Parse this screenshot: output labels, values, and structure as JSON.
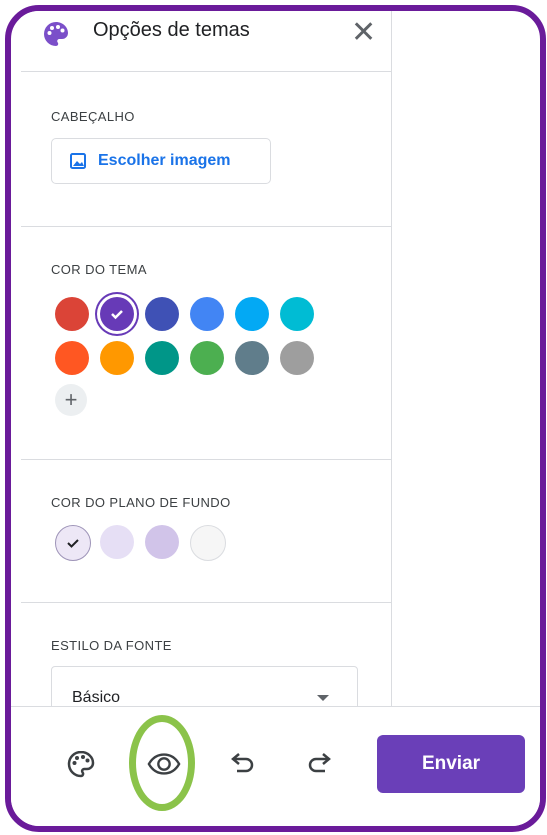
{
  "header": {
    "title": "Opções de temas",
    "close_label": "✕"
  },
  "sections": {
    "header_section": {
      "label": "CABEÇALHO",
      "button_label": "Escolher imagem"
    },
    "theme_color": {
      "label": "COR DO TEMA",
      "colors": [
        "#db4437",
        "#673ab7",
        "#3f51b5",
        "#4285f4",
        "#03a9f4",
        "#00bcd4",
        "#ff5722",
        "#ff9800",
        "#009688",
        "#4caf50",
        "#607d8b",
        "#9e9e9e"
      ],
      "selected_index": 1
    },
    "background_color": {
      "label": "COR DO PLANO DE FUNDO",
      "colors": [
        "#ede7f6",
        "#e6dff5",
        "#d1c4e9",
        "#f6f6f6"
      ],
      "selected_index": 0
    },
    "font_style": {
      "label": "ESTILO DA FONTE",
      "value": "Básico"
    }
  },
  "footer": {
    "send_label": "Enviar"
  },
  "colors": {
    "accent": "#6a3fb8",
    "frame": "#6a1b9a",
    "highlight": "#8bc34a"
  }
}
